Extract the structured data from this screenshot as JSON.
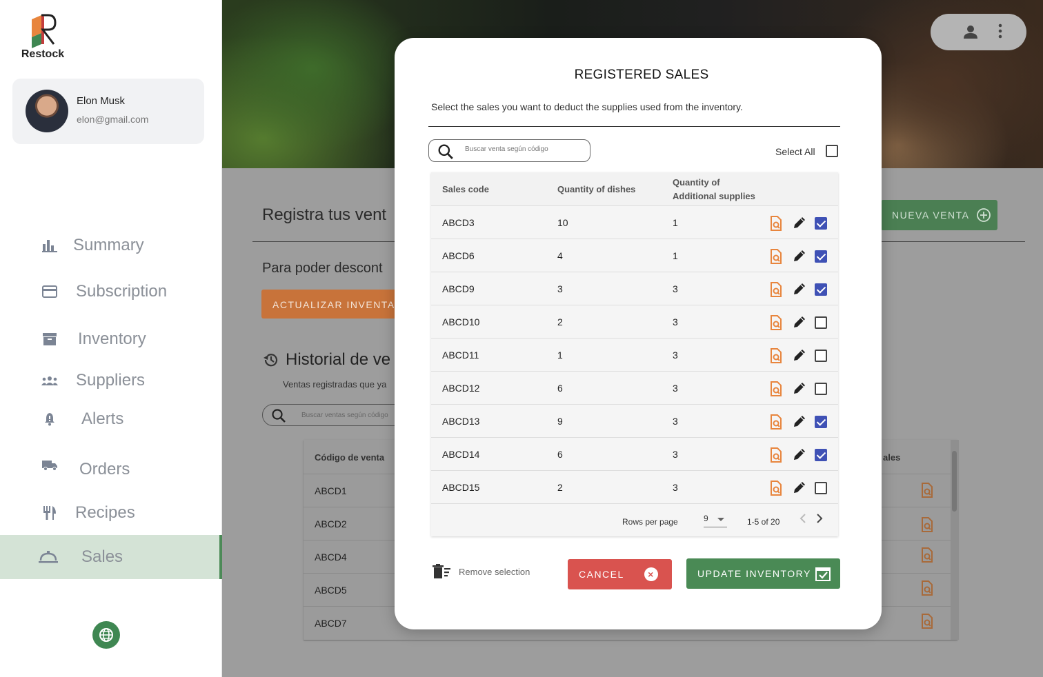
{
  "brand": {
    "name": "Restock"
  },
  "profile": {
    "name": "Elon Musk",
    "email": "elon@gmail.com"
  },
  "nav": [
    {
      "label": "Summary",
      "icon": "bar-chart-icon"
    },
    {
      "label": "Subscription",
      "icon": "credit-card-icon"
    },
    {
      "label": "Inventory",
      "icon": "archive-icon"
    },
    {
      "label": "Suppliers",
      "icon": "group-icon"
    },
    {
      "label": "Alerts",
      "icon": "bell-icon"
    },
    {
      "label": "Orders",
      "icon": "truck-icon"
    },
    {
      "label": "Recipes",
      "icon": "utensils-icon"
    },
    {
      "label": "Sales",
      "icon": "service-bell-icon",
      "active": true
    }
  ],
  "background": {
    "title": "Registra tus vent",
    "subtitle": "Para poder descont",
    "update_button": "ACTUALIZAR INVENTARIO",
    "new_sale_button": "NUEVA VENTA",
    "history_title": "Historial de ve",
    "history_sub": "Ventas registradas que ya",
    "search_placeholder": "Buscar ventas según código",
    "table_head": "Código de venta",
    "table_head_right": "ales",
    "rows": [
      "ABCD1",
      "ABCD2",
      "ABCD4",
      "ABCD5",
      "ABCD7"
    ]
  },
  "modal": {
    "title": "REGISTERED SALES",
    "description": "Select the sales you want to deduct the supplies used from the inventory.",
    "search_placeholder": "Buscar venta según código",
    "select_all": "Select All",
    "columns": {
      "code": "Sales code",
      "dishes": "Quantity  of dishes",
      "supplies_line1": "Quantity of",
      "supplies_line2": "Additional supplies"
    },
    "rows": [
      {
        "code": "ABCD3",
        "dishes": "10",
        "supplies": "1",
        "checked": true
      },
      {
        "code": "ABCD6",
        "dishes": "4",
        "supplies": "1",
        "checked": true
      },
      {
        "code": "ABCD9",
        "dishes": "3",
        "supplies": "3",
        "checked": true
      },
      {
        "code": "ABCD10",
        "dishes": "2",
        "supplies": "3",
        "checked": false
      },
      {
        "code": "ABCD11",
        "dishes": "1",
        "supplies": "3",
        "checked": false
      },
      {
        "code": "ABCD12",
        "dishes": "6",
        "supplies": "3",
        "checked": false
      },
      {
        "code": "ABCD13",
        "dishes": "9",
        "supplies": "3",
        "checked": true
      },
      {
        "code": "ABCD14",
        "dishes": "6",
        "supplies": "3",
        "checked": true
      },
      {
        "code": "ABCD15",
        "dishes": "2",
        "supplies": "3",
        "checked": false
      }
    ],
    "footer": {
      "rows_per_page_label": "Rows per page",
      "rows_per_page": "9",
      "range": "1-5 of 20"
    },
    "remove_selection": "Remove selection",
    "cancel": "CANCEL",
    "update": "UPDATE INVENTORY"
  },
  "colors": {
    "primary_green": "#4a8a55",
    "accent_orange": "#e8853d",
    "danger": "#d9534f",
    "checkbox": "#3f51b5"
  }
}
